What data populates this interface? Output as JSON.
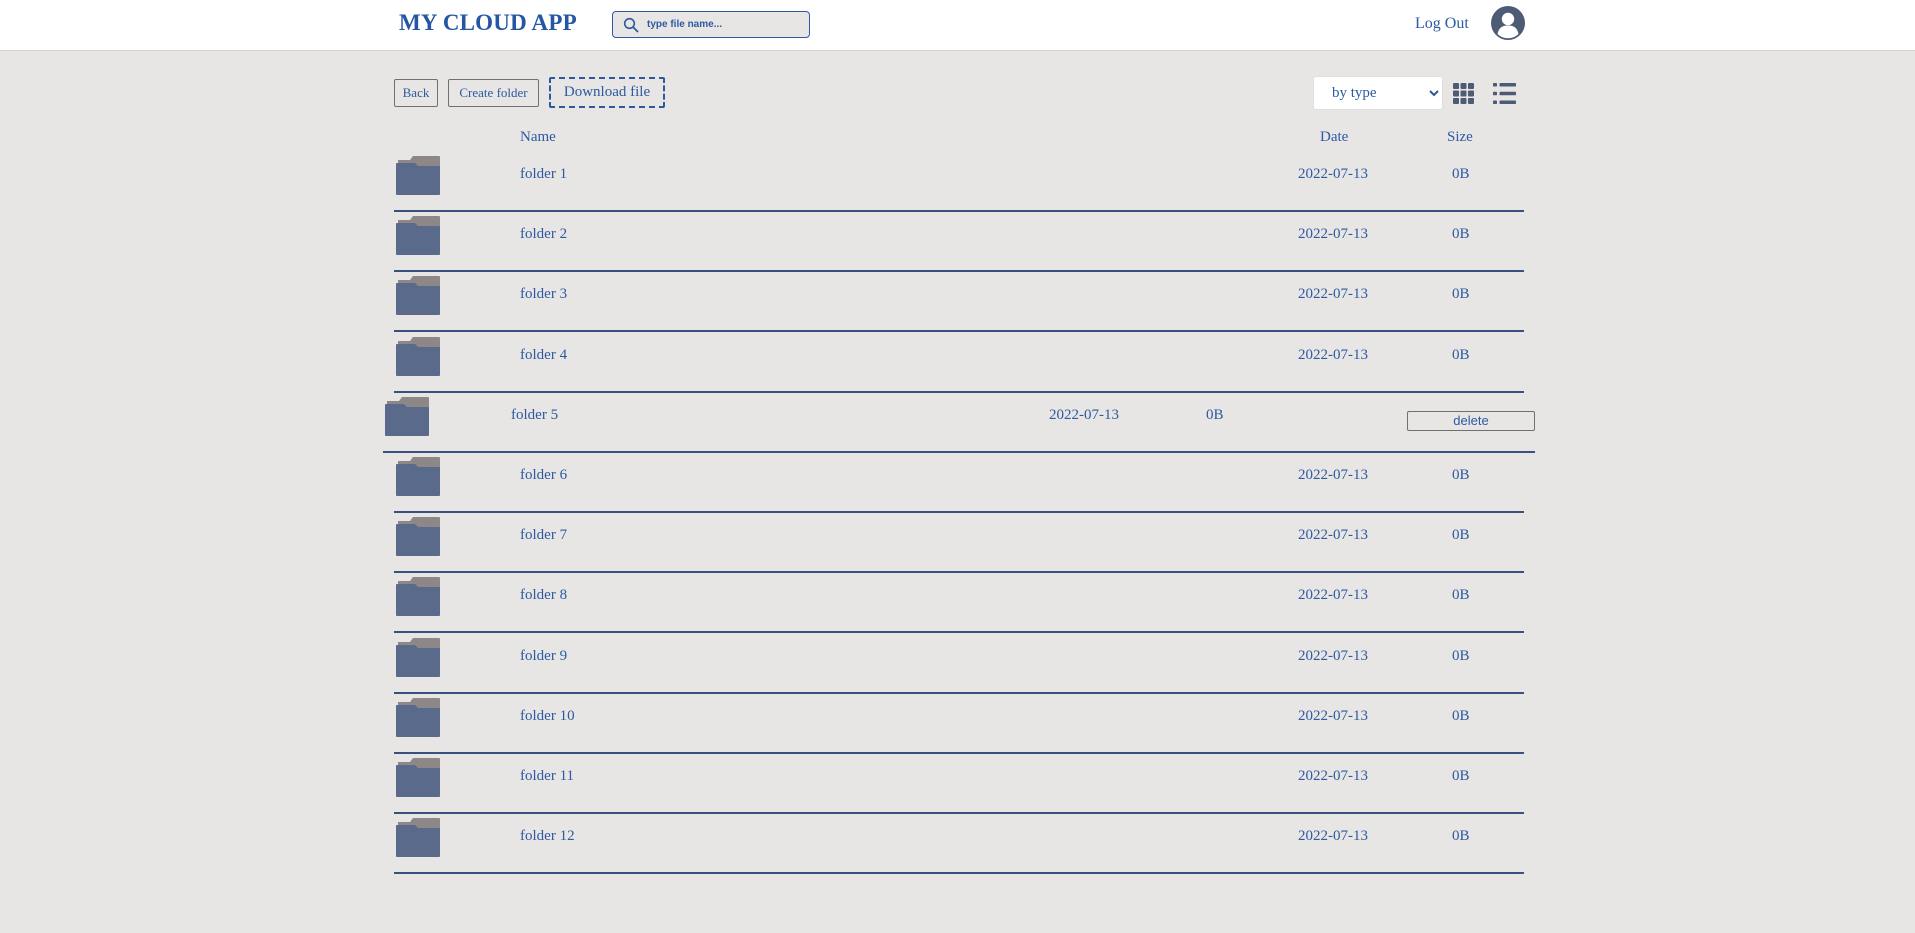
{
  "header": {
    "app_title": "MY CLOUD APP",
    "search_placeholder": "type file name...",
    "logout_label": "Log Out"
  },
  "toolbar": {
    "back_label": "Back",
    "create_folder_label": "Create folder",
    "download_label": "Download file",
    "sort_selected": "by type"
  },
  "columns": {
    "name": "Name",
    "date": "Date",
    "size": "Size"
  },
  "files": [
    {
      "name": "folder 1",
      "date": "2022-07-13",
      "size": "0B"
    },
    {
      "name": "folder 2",
      "date": "2022-07-13",
      "size": "0B"
    },
    {
      "name": "folder 3",
      "date": "2022-07-13",
      "size": "0B"
    },
    {
      "name": "folder 4",
      "date": "2022-07-13",
      "size": "0B"
    },
    {
      "name": "folder 5",
      "date": "2022-07-13",
      "size": "0B",
      "delete_label": "delete"
    },
    {
      "name": "folder 6",
      "date": "2022-07-13",
      "size": "0B"
    },
    {
      "name": "folder 7",
      "date": "2022-07-13",
      "size": "0B"
    },
    {
      "name": "folder 8",
      "date": "2022-07-13",
      "size": "0B"
    },
    {
      "name": "folder 9",
      "date": "2022-07-13",
      "size": "0B"
    },
    {
      "name": "folder 10",
      "date": "2022-07-13",
      "size": "0B"
    },
    {
      "name": "folder 11",
      "date": "2022-07-13",
      "size": "0B"
    },
    {
      "name": "folder 12",
      "date": "2022-07-13",
      "size": "0B"
    }
  ],
  "icons": {
    "search": "search-icon",
    "avatar": "user-avatar-icon",
    "grid_view": "grid-view-icon",
    "list_view": "list-view-icon",
    "folder": "folder-icon"
  },
  "colors": {
    "accent": "#2c5aa0",
    "background": "#e8e5e5",
    "folder_front": "#5a6a8a",
    "folder_back": "#8e8787"
  }
}
